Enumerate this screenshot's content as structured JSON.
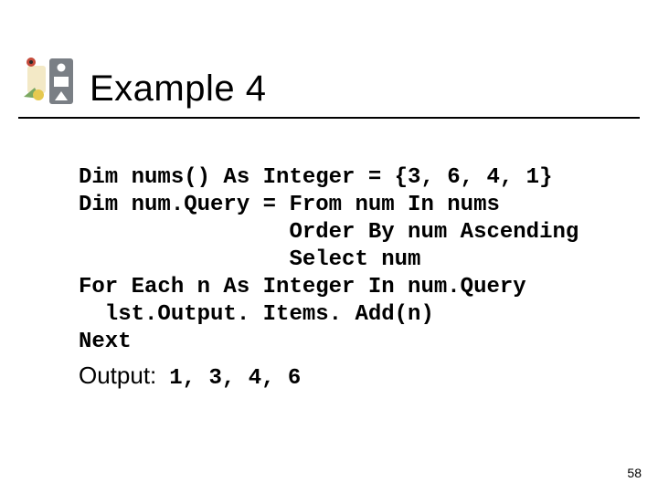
{
  "slide": {
    "title": "Example 4",
    "page_number": "58"
  },
  "code": {
    "lines": [
      "Dim nums() As Integer = {3, 6, 4, 1}",
      "Dim num.Query = From num In nums",
      "                Order By num Ascending",
      "                Select num",
      "For Each n As Integer In num.Query",
      "  lst.Output. Items. Add(n)",
      "Next"
    ]
  },
  "output": {
    "label": "Output:",
    "value": "1, 3, 4, 6"
  },
  "icon": {
    "name": "slide-logo"
  }
}
